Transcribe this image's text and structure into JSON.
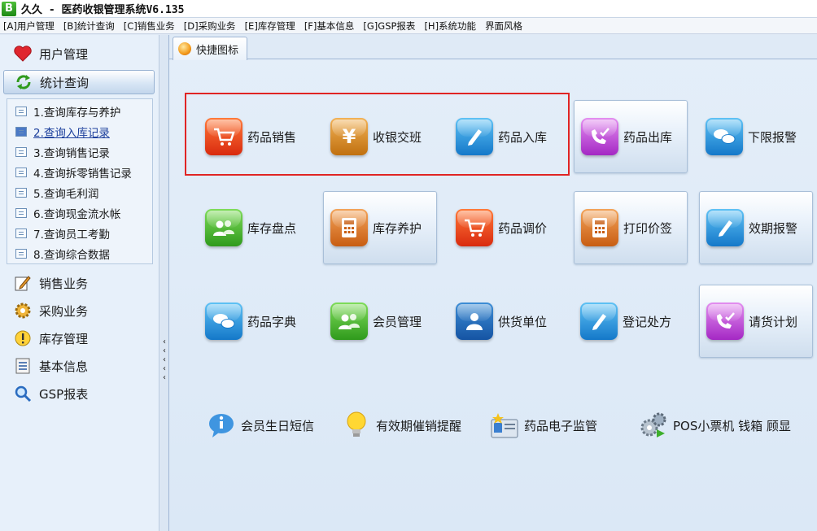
{
  "window": {
    "logo_letter": "B",
    "title": "久久 - 医药收银管理系统V6.135"
  },
  "menubar": [
    "[A]用户管理",
    "[B]统计查询",
    "[C]销售业务",
    "[D]采购业务",
    "[E]库存管理",
    "[F]基本信息",
    "[G]GSP报表",
    "[H]系统功能",
    "界面风格"
  ],
  "sidebar": {
    "user_mgmt": {
      "label": "用户管理",
      "icon": "heart-icon"
    },
    "stats": {
      "label": "统计查询",
      "icon": "refresh-icon"
    },
    "sub_items": [
      "1.查询库存与养护",
      "2.查询入库记录",
      "3.查询销售记录",
      "4.查询拆零销售记录",
      "5.查询毛利润",
      "6.查询现金流水帐",
      "7.查询员工考勤",
      "8.查询综合数据"
    ],
    "active_sub_index": 1,
    "groups": [
      {
        "label": "销售业务",
        "icon": "edit-icon"
      },
      {
        "label": "采购业务",
        "icon": "gear-icon"
      },
      {
        "label": "库存管理",
        "icon": "alert-icon"
      },
      {
        "label": "基本信息",
        "icon": "list-icon"
      },
      {
        "label": "GSP报表",
        "icon": "magnifier-icon"
      }
    ]
  },
  "tab": {
    "label": "快捷图标"
  },
  "tiles": {
    "drug_sales": {
      "label": "药品销售",
      "icon": "cart-icon",
      "color": "#d92a0e"
    },
    "cashier_shift": {
      "label": "收银交班",
      "icon": "yen-icon",
      "color": "#c0700f"
    },
    "drug_stock_in": {
      "label": "药品入库",
      "icon": "pen-icon",
      "color": "#1478c9"
    },
    "drug_stock_out": {
      "label": "药品出库",
      "icon": "phone-check-icon",
      "color": "#a428c4"
    },
    "low_alert": {
      "label": "下限报警",
      "icon": "chat-icon",
      "color": "#1478c9"
    },
    "inventory_count": {
      "label": "库存盘点",
      "icon": "users-icon",
      "color": "#2f9a1c"
    },
    "inventory_care": {
      "label": "库存养护",
      "icon": "calculator-icon",
      "color": "#c85d12"
    },
    "price_adjust": {
      "label": "药品调价",
      "icon": "cart-icon",
      "color": "#d92a0e"
    },
    "print_price_tag": {
      "label": "打印价签",
      "icon": "calculator-icon",
      "color": "#c85d12"
    },
    "expiry_alert": {
      "label": "效期报警",
      "icon": "pen-icon",
      "color": "#1478c9"
    },
    "drug_dictionary": {
      "label": "药品字典",
      "icon": "chat-icon",
      "color": "#1478c9"
    },
    "member_mgmt": {
      "label": "会员管理",
      "icon": "users-icon",
      "color": "#2f9a1c"
    },
    "supplier": {
      "label": "供货单位",
      "icon": "user-icon",
      "color": "#1554a3"
    },
    "prescription_reg": {
      "label": "登记处方",
      "icon": "pen-icon",
      "color": "#1478c9"
    },
    "purchase_plan": {
      "label": "请货计划",
      "icon": "phone-check-icon",
      "color": "#a428c4"
    }
  },
  "bottom_links": {
    "birthday_sms": {
      "label": "会员生日短信",
      "icon": "info-icon"
    },
    "expiry_reminder": {
      "label": "有效期催销提醒",
      "icon": "lightbulb-icon"
    },
    "e_supervision": {
      "label": "药品电子监管",
      "icon": "id-card-icon"
    },
    "pos_devices": {
      "label": "POS小票机 钱箱 顾显",
      "icon": "gears-icon"
    }
  }
}
